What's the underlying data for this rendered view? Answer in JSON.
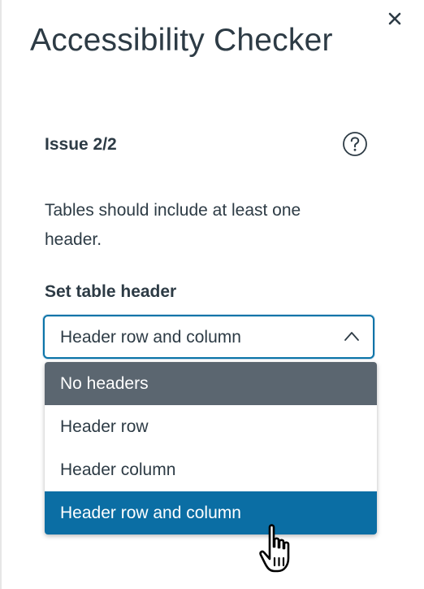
{
  "panel": {
    "title": "Accessibility Checker",
    "close_icon": "close-icon"
  },
  "issue": {
    "label": "Issue 2/2",
    "help_icon": "question-circle-icon",
    "description": "Tables should include at least one header."
  },
  "table_header_field": {
    "label": "Set table header",
    "current_value": "Header row and column",
    "options": [
      {
        "label": "No headers",
        "state": "hovered"
      },
      {
        "label": "Header row",
        "state": "normal"
      },
      {
        "label": "Header column",
        "state": "normal"
      },
      {
        "label": "Header row and column",
        "state": "selected"
      }
    ],
    "expanded": true
  },
  "colors": {
    "text": "#2d3b45",
    "focus_border": "#0b74a8",
    "hover_option_bg": "#5b6670",
    "selected_option_bg": "#0b6ea4"
  }
}
